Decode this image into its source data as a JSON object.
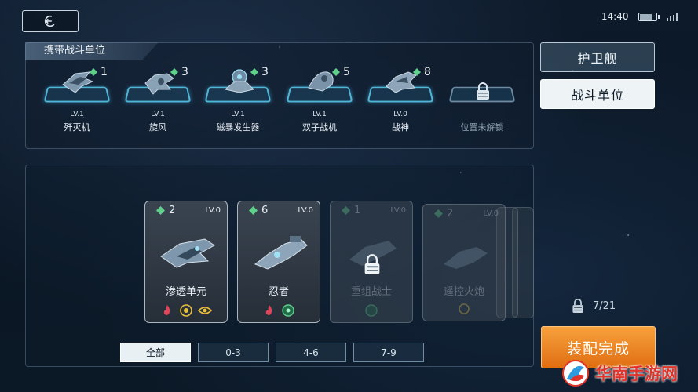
{
  "status": {
    "time": "14:40",
    "battery_level": 0.75
  },
  "top_panel": {
    "title": "携带战斗单位",
    "slots": [
      {
        "level": "LV.1",
        "name": "歼灭机",
        "cost": "1"
      },
      {
        "level": "LV.1",
        "name": "旋风",
        "cost": "3"
      },
      {
        "level": "LV.1",
        "name": "磁暴发生器",
        "cost": "3"
      },
      {
        "level": "LV.1",
        "name": "双子战机",
        "cost": "5"
      },
      {
        "level": "LV.0",
        "name": "战神",
        "cost": "8"
      },
      {
        "name": "位置未解锁",
        "locked": true
      }
    ]
  },
  "side_tabs": {
    "escort": "护卫舰",
    "combat_units": "战斗单位"
  },
  "cards": [
    {
      "cost": "2",
      "level": "LV.0",
      "name": "渗透单元",
      "available": true
    },
    {
      "cost": "6",
      "level": "LV.0",
      "name": "忍者",
      "available": true
    },
    {
      "cost": "1",
      "level": "LV.0",
      "name": "重组战士",
      "available": false
    },
    {
      "cost": "2",
      "level": "LV.0",
      "name": "遥控火炮",
      "available": false
    }
  ],
  "filters": [
    "全部",
    "0-3",
    "4-6",
    "7-9"
  ],
  "selected_filter": "全部",
  "capacity": "7/21",
  "assemble_button": "装配完成",
  "watermark": "华南手游网",
  "colors": {
    "accent_cyan": "#4fb6d8",
    "assemble_orange": "#f08a24",
    "gem_green": "#5fd08a"
  },
  "icons": [
    "back-icon",
    "battery-icon",
    "signal-icon",
    "gem-icon",
    "lock-icon",
    "fire-icon",
    "sun-icon",
    "eye-icon",
    "orb-icon"
  ]
}
